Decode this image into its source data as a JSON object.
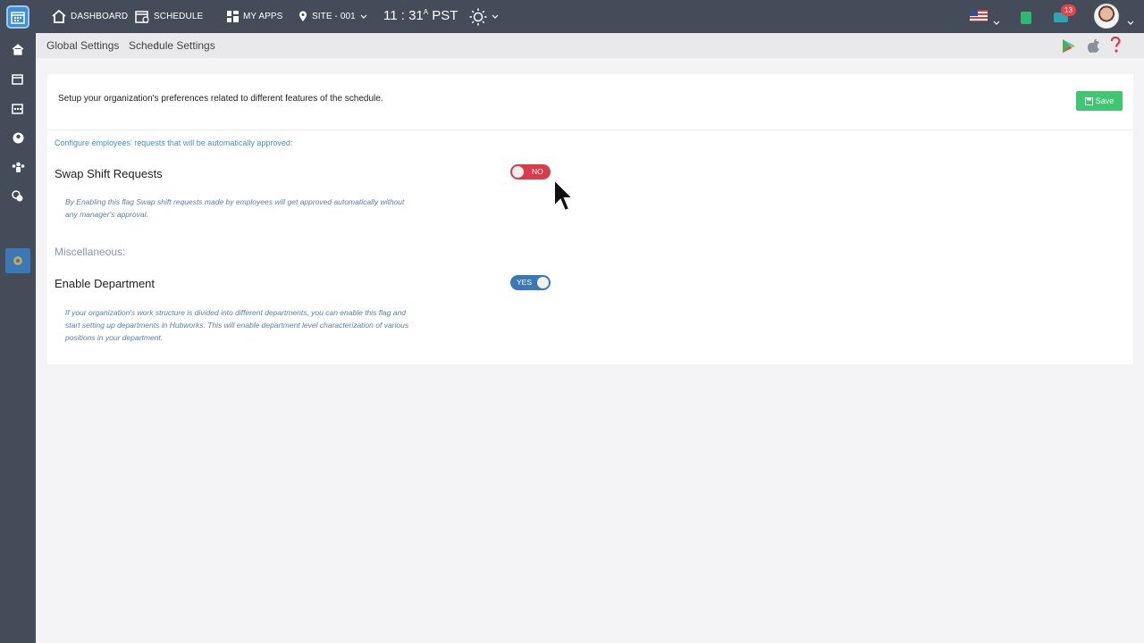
{
  "nav": {
    "dashboard": "DASHBOARD",
    "schedule": "SCHEDULE",
    "my_apps": "MY APPS",
    "site": "SITE - 001",
    "time": "11 : 31",
    "time_sup": "A",
    "timezone": "PST",
    "mail_count": "13"
  },
  "breadcrumb": {
    "root": "Global Settings",
    "current": "Schedule Settings"
  },
  "main": {
    "intro": "Setup your organization's preferences related to different features of the schedule.",
    "save_label": "Save",
    "auto_approve_note": "Configure employees' requests that will be automatically approved:",
    "swap": {
      "title": "Swap Shift Requests",
      "toggle_label": "NO",
      "desc": "By Enabling this flag Swap shift requests made by employees will get approved automatically without any manager's approval."
    },
    "misc_heading": "Miscellaneous:",
    "department": {
      "title": "Enable Department",
      "toggle_label": "YES",
      "desc": "If your organization's work structure is divided into different departments, you can enable this flag and start setting up departments in Hubworks. This will enable department level characterization of various positions in your department."
    }
  },
  "colors": {
    "topbar": "#444b59",
    "toggle_off": "#d83b4b",
    "toggle_on": "#3a78b8",
    "save": "#3ec671"
  },
  "icons": [
    "app-logo-icon",
    "home-icon",
    "schedule-icon",
    "apps-grid-icon",
    "location-pin-icon",
    "sun-icon",
    "us-flag-icon",
    "bag-icon",
    "mail-icon",
    "play-store-icon",
    "apple-icon",
    "help-icon",
    "save-icon"
  ]
}
